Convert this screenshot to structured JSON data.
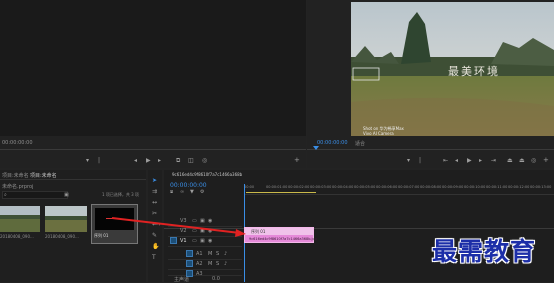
{
  "source_monitor": {
    "timecode": "00:00:00:00"
  },
  "program_monitor": {
    "timecode": "00:00:00:00",
    "fit_label": "适合",
    "video_overlay_text": "最美环境",
    "camera_stamp_1": "Shot on 华为畅享Max",
    "camera_stamp_2": "Vivo AI Camera"
  },
  "project_panel": {
    "tab_project": "项目:未命名",
    "tab_bin": "项目:未命名",
    "project_file": "未命名.prproj",
    "selection_info": "1 项已选择，共 3 项",
    "clip1_name": "20180408_090...",
    "clip2_name": "20180408_090...",
    "clip3_name": "序列 01"
  },
  "timeline": {
    "sequence_name": "9c616ed4c9f8610f7a7c1466a368b",
    "timecode": "00:00:00:00",
    "ruler": [
      "00:00",
      "00:00:01:00",
      "00:00:02:00",
      "00:00:03:00",
      "00:00:04:00",
      "00:00:05:00",
      "00:00:06:00",
      "00:00:07:00",
      "00:00:08:00",
      "00:00:09:00",
      "00:00:10:00",
      "00:00:11:00",
      "00:00:12:00",
      "00:00:13:00"
    ],
    "video_tracks": [
      "V3",
      "V2",
      "V1"
    ],
    "audio_tracks": [
      "A1",
      "A2",
      "A3"
    ],
    "master_label": "主声道",
    "master_value": "0.0",
    "clip_title": "序列 01",
    "clip_file": "9c616ed4c9f8610f7a7c1466a368b.jpg"
  },
  "watermark": "最需教育",
  "colors": {
    "accent": "#3a8ee6",
    "clip": "#e58ad9",
    "arrow": "#e02222"
  }
}
